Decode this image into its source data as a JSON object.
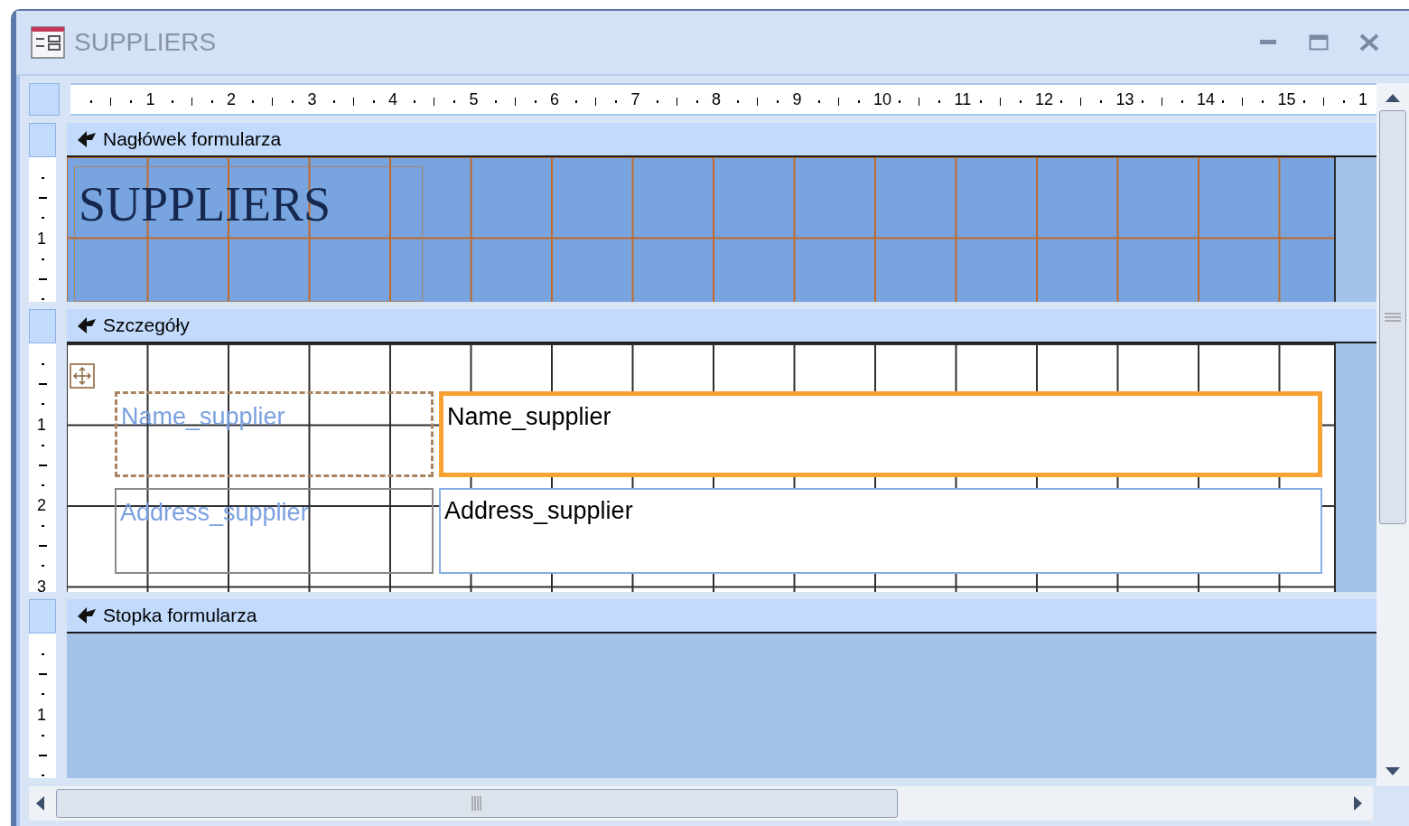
{
  "window": {
    "title": "SUPPLIERS"
  },
  "ruler": {
    "horizontal": [
      "1",
      "2",
      "3",
      "4",
      "5",
      "6",
      "7",
      "8",
      "9",
      "10",
      "11",
      "12",
      "13",
      "14",
      "15",
      "1"
    ]
  },
  "sections": [
    {
      "kind": "header",
      "title": "Nagłówek formularza",
      "ruler": [
        "1"
      ],
      "controls": [
        {
          "kind": "title",
          "text": "SUPPLIERS",
          "selected": false
        }
      ]
    },
    {
      "kind": "detail",
      "title": "Szczegóły",
      "ruler": [
        "1",
        "2",
        "3"
      ],
      "controls": [
        {
          "kind": "label",
          "text": "Name_supplier",
          "selected": true
        },
        {
          "kind": "textbox",
          "text": "Name_supplier",
          "selected": true
        },
        {
          "kind": "label",
          "text": "Address_supplier",
          "selected": false
        },
        {
          "kind": "textbox",
          "text": "Address_supplier",
          "selected": false
        }
      ]
    },
    {
      "kind": "footer",
      "title": "Stopka formularza",
      "ruler": [
        "1"
      ]
    }
  ]
}
